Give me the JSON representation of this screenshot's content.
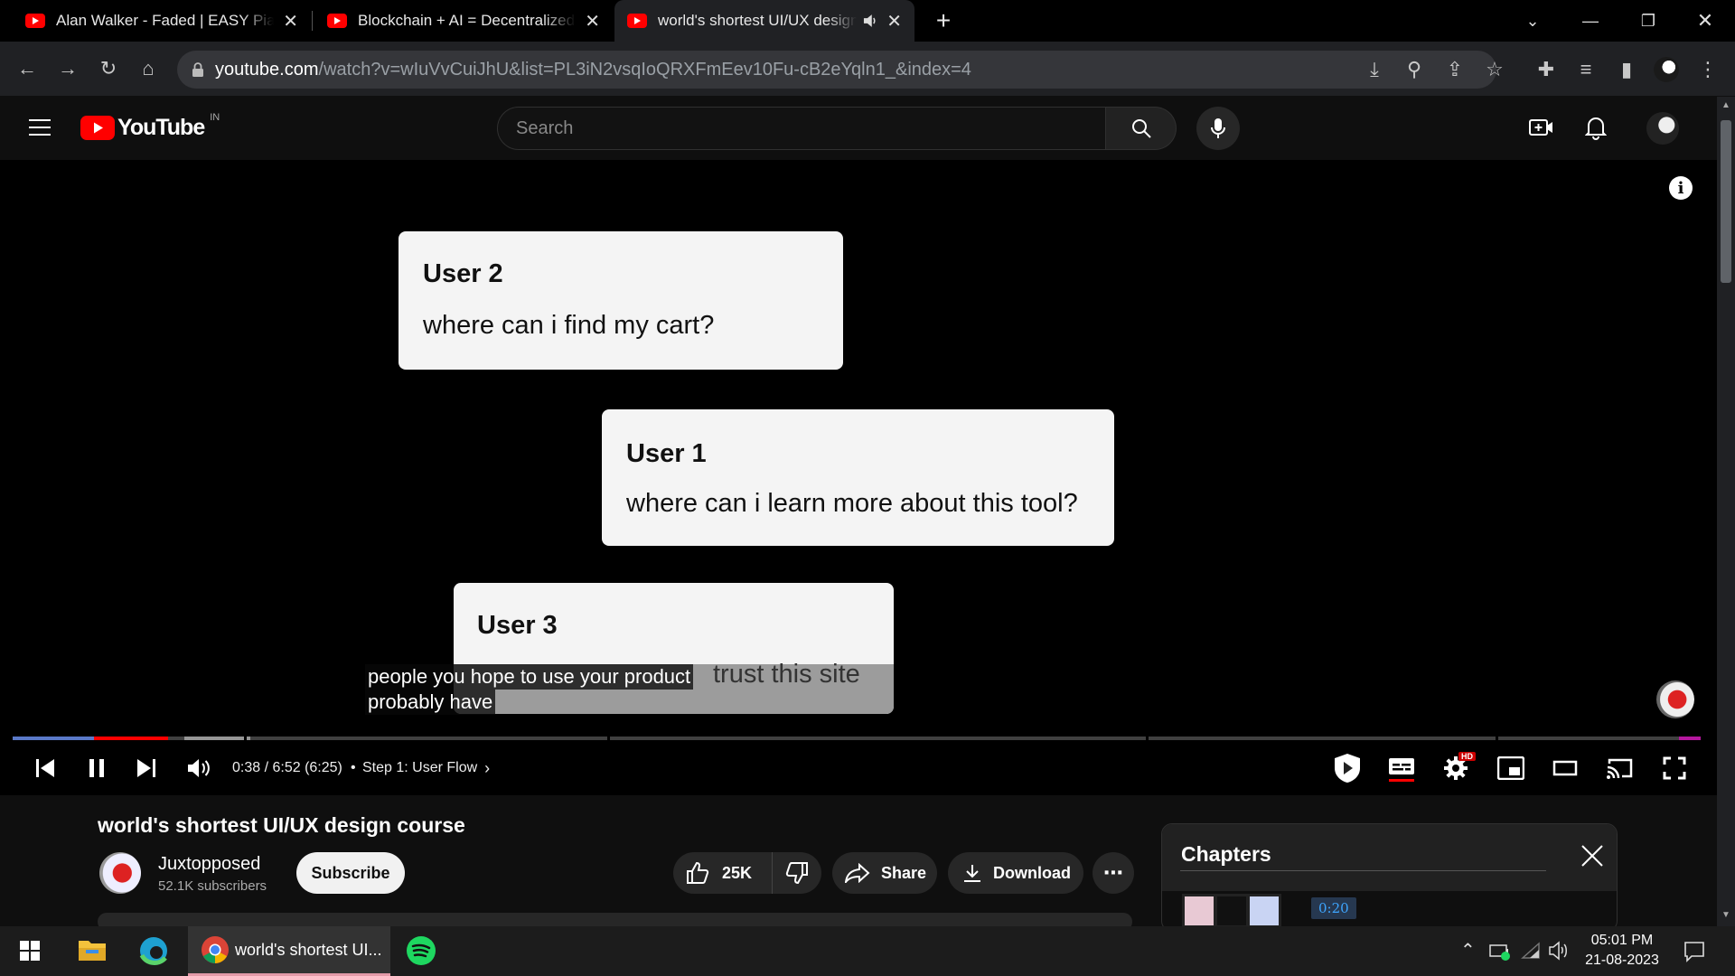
{
  "browser": {
    "tabs": [
      {
        "title": "Alan Walker - Faded | EASY Piano"
      },
      {
        "title": "Blockchain + AI = Decentralized AI"
      },
      {
        "title": "world's shortest UI/UX design course",
        "active": true
      }
    ],
    "url_host": "youtube.com",
    "url_path": "/watch?v=wIuVvCuiJhU&list=PL3iN2vsqIoQRXFmEev10Fu-cB2eYqln1_&index=4"
  },
  "youtube": {
    "logo_text": "YouTube",
    "region": "IN",
    "search_placeholder": "Search"
  },
  "video": {
    "cards": [
      {
        "user": "User 2",
        "message": "where can i find my cart?"
      },
      {
        "user": "User 1",
        "message": "where can i learn more about this tool?"
      },
      {
        "user": "User 3",
        "message": "trust this site"
      }
    ],
    "captions": {
      "line1": "people you hope to use your product",
      "line2": "probably have"
    },
    "time": "0:38 / 6:52 (6:25)",
    "chapter": "Step 1: User Flow",
    "progress_fraction": 0.092,
    "settings_badge": "HD"
  },
  "meta": {
    "title": "world's shortest UI/UX design course",
    "channel": "Juxtopposed",
    "subscribers": "52.1K subscribers",
    "subscribe_label": "Subscribe",
    "likes": "25K",
    "share_label": "Share",
    "download_label": "Download"
  },
  "chapters": {
    "heading": "Chapters",
    "first_time": "0:20"
  },
  "taskbar": {
    "app_label": "world's shortest UI...",
    "time": "05:01 PM",
    "date": "21-08-2023"
  },
  "colors": {
    "youtube_red": "#ff0000",
    "accent_blue": "#3ea6ff"
  }
}
